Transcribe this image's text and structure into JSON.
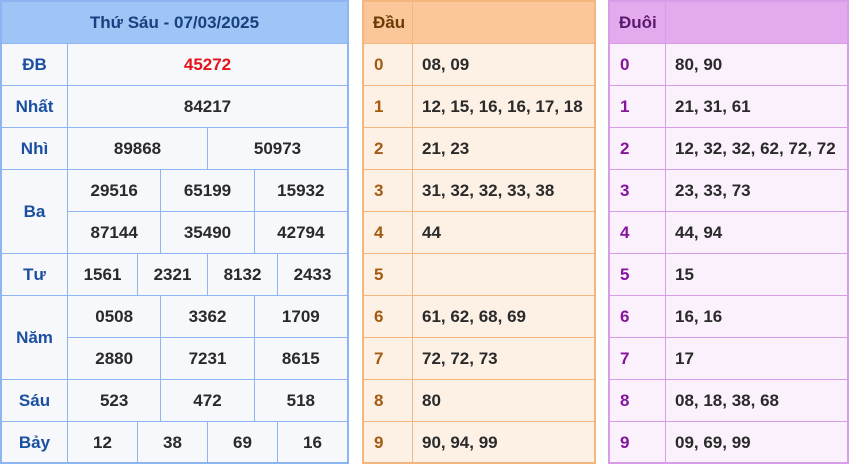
{
  "results": {
    "title": "Thứ Sáu - 07/03/2025",
    "prizes": [
      {
        "label": "ĐB",
        "lines": [
          [
            "45272"
          ]
        ],
        "special": true
      },
      {
        "label": "Nhất",
        "lines": [
          [
            "84217"
          ]
        ]
      },
      {
        "label": "Nhì",
        "lines": [
          [
            "89868",
            "50973"
          ]
        ]
      },
      {
        "label": "Ba",
        "lines": [
          [
            "29516",
            "65199",
            "15932"
          ],
          [
            "87144",
            "35490",
            "42794"
          ]
        ]
      },
      {
        "label": "Tư",
        "lines": [
          [
            "1561",
            "2321",
            "8132",
            "2433"
          ]
        ]
      },
      {
        "label": "Năm",
        "lines": [
          [
            "0508",
            "3362",
            "1709"
          ],
          [
            "2880",
            "7231",
            "8615"
          ]
        ]
      },
      {
        "label": "Sáu",
        "lines": [
          [
            "523",
            "472",
            "518"
          ]
        ]
      },
      {
        "label": "Bảy",
        "lines": [
          [
            "12",
            "38",
            "69",
            "16"
          ]
        ]
      }
    ]
  },
  "dau": {
    "header": "Đầu",
    "rows": [
      {
        "key": "0",
        "value": "08, 09"
      },
      {
        "key": "1",
        "value": "12, 15, 16, 16, 17, 18"
      },
      {
        "key": "2",
        "value": "21, 23"
      },
      {
        "key": "3",
        "value": "31, 32, 32, 33, 38"
      },
      {
        "key": "4",
        "value": "44"
      },
      {
        "key": "5",
        "value": ""
      },
      {
        "key": "6",
        "value": "61, 62, 68, 69"
      },
      {
        "key": "7",
        "value": "72, 72, 73"
      },
      {
        "key": "8",
        "value": "80"
      },
      {
        "key": "9",
        "value": "90, 94, 99"
      }
    ]
  },
  "duoi": {
    "header": "Đuôi",
    "rows": [
      {
        "key": "0",
        "value": "80, 90"
      },
      {
        "key": "1",
        "value": "21, 31, 61"
      },
      {
        "key": "2",
        "value": "12, 32, 32, 62, 72, 72"
      },
      {
        "key": "3",
        "value": "23, 33, 73"
      },
      {
        "key": "4",
        "value": "44, 94"
      },
      {
        "key": "5",
        "value": "15"
      },
      {
        "key": "6",
        "value": "16, 16"
      },
      {
        "key": "7",
        "value": "17"
      },
      {
        "key": "8",
        "value": "08, 18, 38, 68"
      },
      {
        "key": "9",
        "value": "09, 69, 99"
      }
    ]
  }
}
